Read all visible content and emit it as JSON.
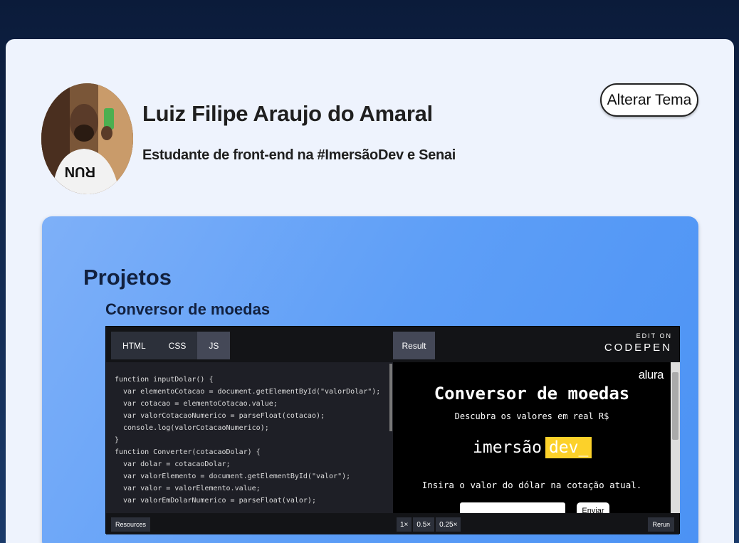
{
  "profile": {
    "name": "Luiz Filipe Araujo do Amaral",
    "bio": "Estudante de front-end na #ImersãoDev e Senai",
    "avatar_shirt_text": "RUN",
    "theme_button": "Alterar Tema"
  },
  "projects": {
    "title": "Projetos",
    "items": [
      {
        "title": "Conversor de moedas"
      }
    ]
  },
  "codepen": {
    "tabs": [
      "HTML",
      "CSS",
      "JS"
    ],
    "active_tab": "JS",
    "result_tab": "Result",
    "edit_on": "EDIT ON",
    "brand": "CODEPEN",
    "code_lines": [
      "function inputDolar() {",
      "  var elementoCotacao = document.getElementById(\"valorDolar\");",
      "  var cotacao = elementoCotacao.value;",
      "  var valorCotacaoNumerico = parseFloat(cotacao);",
      "  console.log(valorCotacaoNumerico);",
      "}",
      "",
      "function Converter(cotacaoDolar) {",
      "  var dolar = cotacaoDolar;",
      "  var valorElemento = document.getElementById(\"valor\");",
      "  var valor = valorElemento.value;",
      "  var valorEmDolarNumerico = parseFloat(valor);"
    ],
    "result": {
      "logo": "alura",
      "title": "Conversor de moedas",
      "subtitle": "Descubra os valores em real R$",
      "brand_left": "imersão",
      "brand_right": "dev_",
      "prompt": "Insira o valor do dólar na cotação atual.",
      "button": "Enviar"
    },
    "footer": {
      "resources": "Resources",
      "zoom": [
        "1×",
        "0.5×",
        "0.25×"
      ],
      "rerun": "Rerun"
    }
  }
}
